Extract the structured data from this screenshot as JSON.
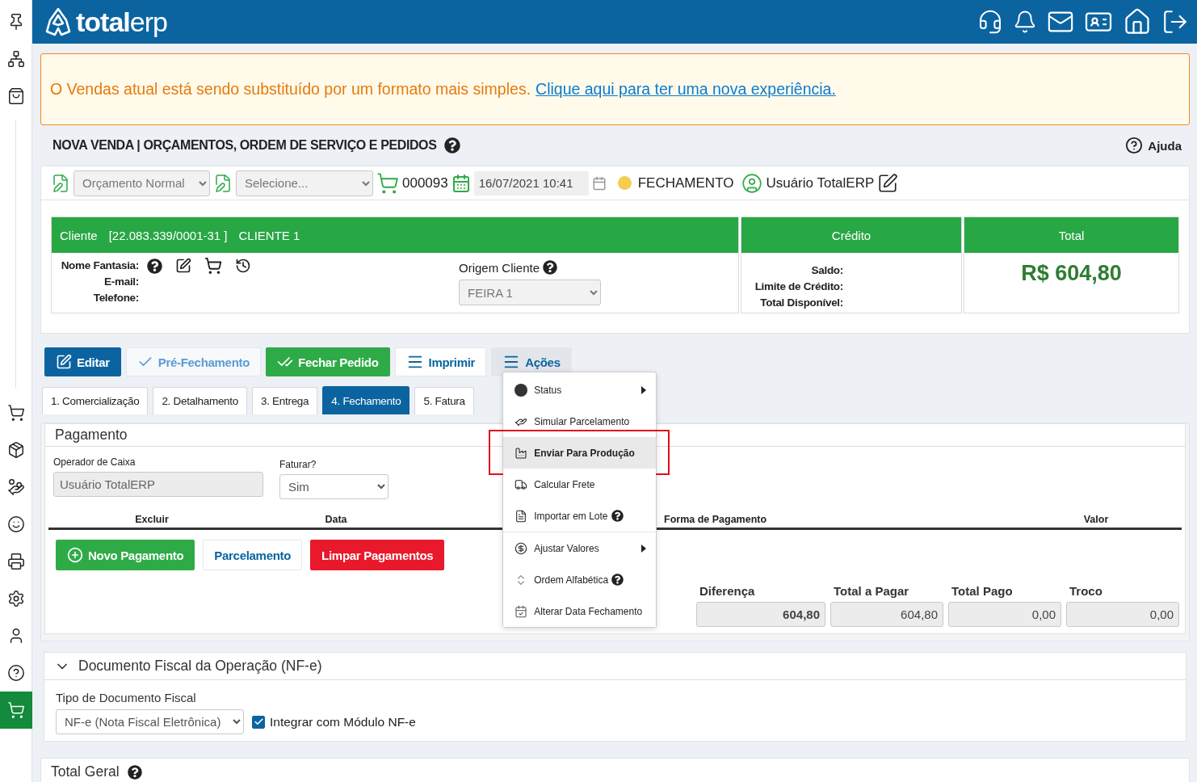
{
  "sidebar": {
    "items": [
      {
        "kind": "pin",
        "selected": false
      },
      {
        "kind": "network",
        "selected": false
      },
      {
        "kind": "bag",
        "selected": false
      },
      {
        "kind": "cart",
        "selected": false
      },
      {
        "kind": "box",
        "selected": false
      },
      {
        "kind": "money",
        "selected": false
      },
      {
        "kind": "smile",
        "selected": false
      },
      {
        "kind": "printer",
        "selected": false
      },
      {
        "kind": "gear",
        "selected": false
      },
      {
        "kind": "user",
        "selected": false
      },
      {
        "kind": "help",
        "selected": false
      },
      {
        "kind": "cart",
        "selected": true
      }
    ]
  },
  "header": {
    "logo_bold": "total",
    "logo_light": "erp"
  },
  "alert": {
    "text": "O Vendas atual está sendo substituído por um formato mais simples.",
    "link": "Clique aqui para ter uma nova experiência."
  },
  "page": {
    "title": "NOVA VENDA | ORÇAMENTOS, ORDEM DE SERVIÇO E PEDIDOS",
    "help": "Ajuda"
  },
  "toolbar": {
    "type_value": "Orçamento Normal",
    "second_placeholder": "Selecione...",
    "number": "000093",
    "datetime": "16/07/2021 10:41",
    "status": "FECHAMENTO",
    "user": "Usuário TotalERP"
  },
  "client": {
    "label": "Cliente",
    "document": "[22.083.339/0001-31 ]",
    "name": "CLIENTE 1",
    "fields": [
      "Nome Fantasia:",
      "E-mail:",
      "Telefone:"
    ],
    "origin_label": "Origem Cliente",
    "origin_value": "FEIRA 1"
  },
  "credit": {
    "title": "Crédito",
    "fields": [
      "Saldo:",
      "Limite de Crédito:",
      "Total Disponível:"
    ]
  },
  "total": {
    "title": "Total",
    "value": "R$ 604,80"
  },
  "actions": [
    {
      "kind": "edit",
      "label": "Editar"
    },
    {
      "kind": "pre",
      "label": "Pré-Fechamento"
    },
    {
      "kind": "close",
      "label": "Fechar Pedido"
    },
    {
      "kind": "print",
      "label": "Imprimir"
    },
    {
      "kind": "menu",
      "label": "Ações",
      "expanded": true
    }
  ],
  "menu": [
    {
      "kind": "dot",
      "label": "Status",
      "submenu": true,
      "help": false,
      "selected": false
    },
    {
      "kind": "hand",
      "label": "Simular Parcelamento",
      "submenu": false,
      "help": false,
      "selected": false
    },
    {
      "kind": "factory",
      "label": "Enviar Para Produção",
      "submenu": false,
      "help": false,
      "selected": true
    },
    {
      "kind": "truck",
      "label": "Calcular Frete",
      "submenu": false,
      "help": false,
      "selected": false
    },
    {
      "kind": "file",
      "label": "Importar em Lote",
      "submenu": false,
      "help": true,
      "selected": false
    },
    {
      "kind": "dollar",
      "label": "Ajustar Valores",
      "submenu": true,
      "help": false,
      "selected": false
    },
    {
      "kind": "sort",
      "label": "Ordem Alfabética",
      "submenu": false,
      "help": true,
      "selected": false
    },
    {
      "kind": "calendar",
      "label": "Alterar Data Fechamento",
      "submenu": false,
      "help": false,
      "selected": false
    }
  ],
  "tabs": [
    {
      "label": "1. Comercialização",
      "selected": false
    },
    {
      "label": "2. Detalhamento",
      "selected": false
    },
    {
      "label": "3. Entrega",
      "selected": false
    },
    {
      "label": "4. Fechamento",
      "selected": true
    },
    {
      "label": "5. Fatura",
      "selected": false
    }
  ],
  "payment": {
    "title": "Pagamento",
    "operator_label": "Operador de Caixa",
    "operator_value": "Usuário TotalERP",
    "invoice_label": "Faturar?",
    "invoice_value": "Sim",
    "columns": [
      "Excluir",
      "Data",
      "Forma de Pagamento",
      "Valor"
    ],
    "buttons": [
      {
        "kind": "add",
        "label": "Novo Pagamento"
      },
      {
        "kind": "plain",
        "label": "Parcelamento"
      },
      {
        "kind": "danger",
        "label": "Limpar Pagamentos"
      }
    ],
    "summary": [
      {
        "label": "Diferença",
        "value": "604,80",
        "bold": true
      },
      {
        "label": "Total a Pagar",
        "value": "604,80",
        "bold": false
      },
      {
        "label": "Total Pago",
        "value": "0,00",
        "bold": false
      },
      {
        "label": "Troco",
        "value": "0,00",
        "bold": false
      }
    ]
  },
  "nfe": {
    "title": "Documento Fiscal da Operação (NF-e)",
    "expanded": true,
    "type_label": "Tipo de Documento Fiscal",
    "type_value": "NF-e (Nota Fiscal Eletrônica)",
    "integrate_label": "Integrar com Módulo NF-e",
    "integrate_checked": true
  },
  "total_geral": {
    "title": "Total Geral"
  }
}
